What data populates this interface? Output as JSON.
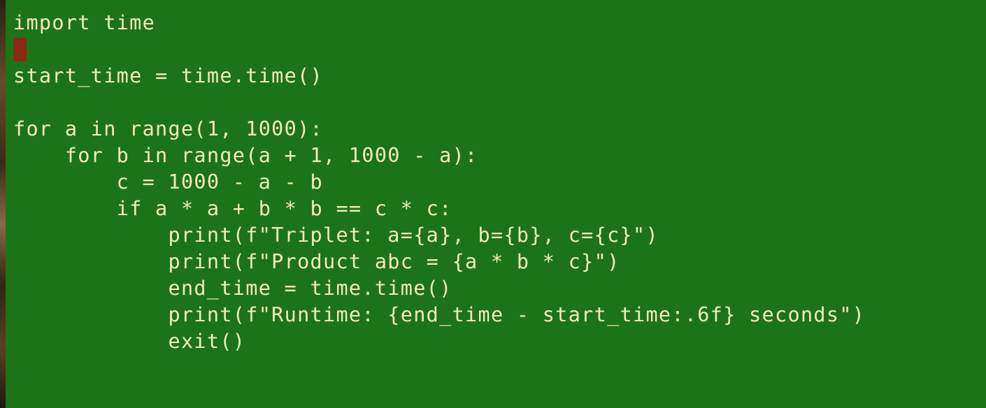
{
  "editor": {
    "lines": [
      "import time",
      "",
      "start_time = time.time()",
      "",
      "for a in range(1, 1000):",
      "    for b in range(a + 1, 1000 - a):",
      "        c = 1000 - a - b",
      "        if a * a + b * b == c * c:",
      "            print(f\"Triplet: a={a}, b={b}, c={c}\")",
      "            print(f\"Product abc = {a * b * c}\")",
      "            end_time = time.time()",
      "            print(f\"Runtime: {end_time - start_time:.6f} seconds\")",
      "            exit()"
    ]
  },
  "colors": {
    "background": "#1c7419",
    "text": "#f3ecb6",
    "cursor": "#8a2a14"
  }
}
